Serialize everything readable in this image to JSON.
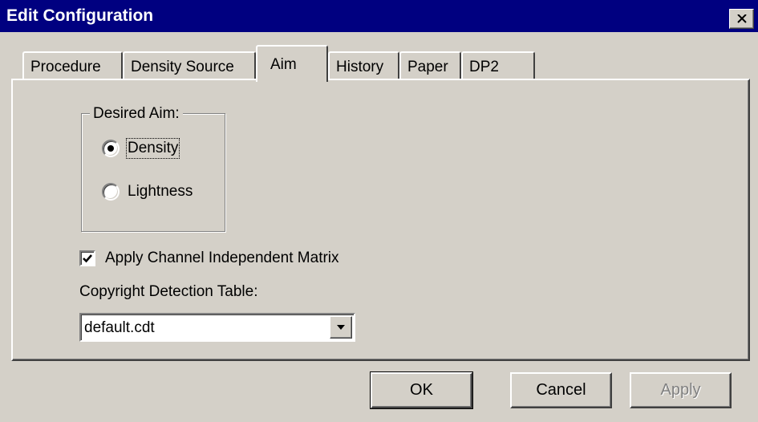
{
  "window": {
    "title": "Edit Configuration"
  },
  "tabs": [
    {
      "label": "Procedure",
      "active": false
    },
    {
      "label": "Density Source",
      "active": false
    },
    {
      "label": "Aim",
      "active": true
    },
    {
      "label": "History",
      "active": false
    },
    {
      "label": "Paper",
      "active": false
    },
    {
      "label": "DP2",
      "active": false
    }
  ],
  "aim": {
    "group_title": "Desired Aim:",
    "options": [
      {
        "label": "Density",
        "selected": true
      },
      {
        "label": "Lightness",
        "selected": false
      }
    ],
    "checkbox": {
      "label": "Apply Channel Independent Matrix",
      "checked": true
    },
    "copyright_label": "Copyright Detection Table:",
    "copyright_value": "default.cdt"
  },
  "buttons": {
    "ok": "OK",
    "cancel": "Cancel",
    "apply": "Apply"
  },
  "colors": {
    "titlebar": "#000080",
    "face": "#d4d0c8"
  }
}
